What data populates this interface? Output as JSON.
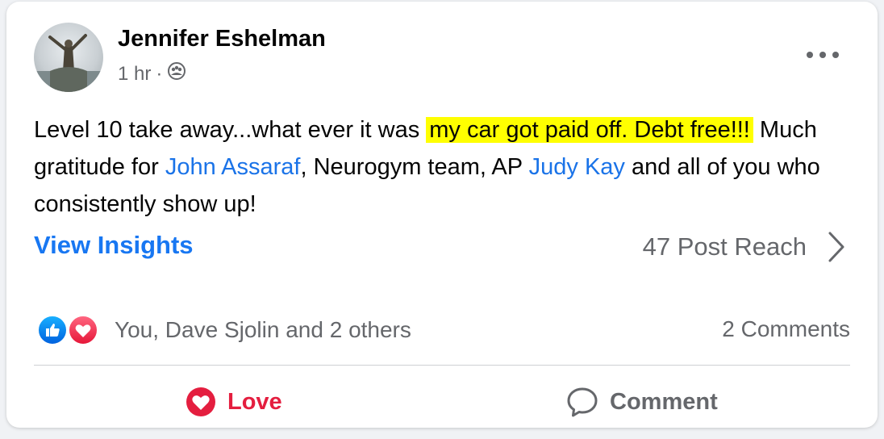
{
  "post": {
    "author": "Jennifer Eshelman",
    "time": "1 hr",
    "separator": "·",
    "privacy_icon": "group-icon",
    "text_part1": "Level 10 take away...what ever it was ",
    "highlight": "my car got paid off.  Debt free!!!",
    "text_part2": " Much gratitude for ",
    "mention1": "John Assaraf",
    "text_part3": ", Neurogym team, AP ",
    "mention2": "Judy Kay",
    "text_part4": " and all of you who consistently show up!"
  },
  "insights": {
    "link_label": "View Insights",
    "reach": "47 Post Reach"
  },
  "reactions": {
    "summary": "You, Dave Sjolin and 2 others",
    "icons": [
      "like-icon",
      "love-icon"
    ],
    "comments": "2 Comments"
  },
  "actions": {
    "love_label": "Love",
    "comment_label": "Comment"
  },
  "colors": {
    "highlight": "#ffff00",
    "link": "#1877f2",
    "mention": "#1a73e8",
    "love": "#e41e3f",
    "secondary_text": "#65676b"
  }
}
